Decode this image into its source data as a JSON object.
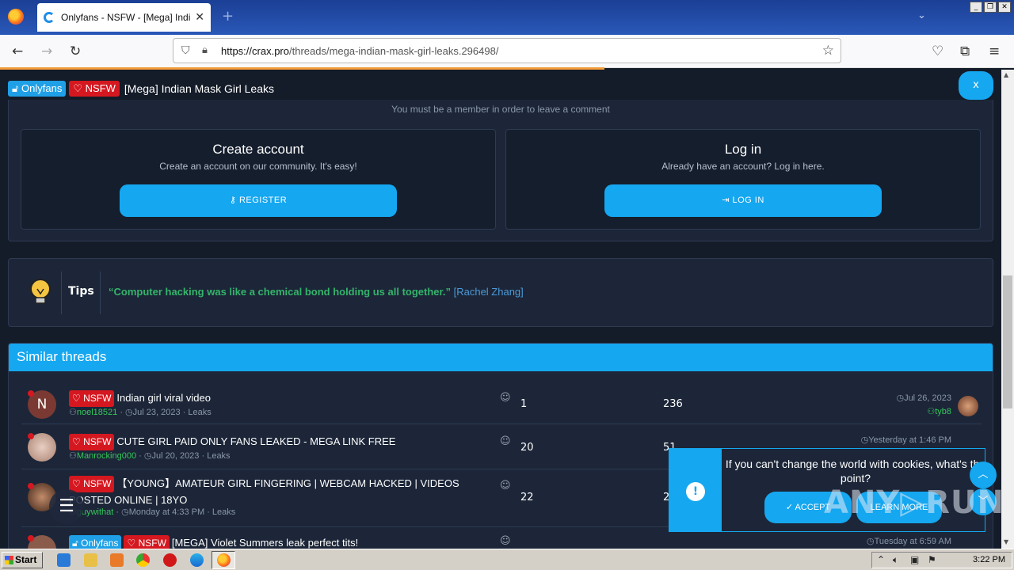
{
  "browser": {
    "tab_title": "Onlyfans - NSFW - [Mega] Indian Mask Girl Leaks",
    "tab_close": "✕",
    "new_tab": "+",
    "url_host": "https://crax.pro",
    "url_path": "/threads/mega-indian-mask-girl-leaks.296498/",
    "window_buttons": [
      "_",
      "❐",
      "✕"
    ],
    "icons": [
      "back-icon",
      "forward-icon",
      "reload-icon",
      "shield-icon",
      "lock-icon",
      "star-icon",
      "pocket-icon",
      "extensions-icon",
      "menu-icon"
    ]
  },
  "thread": {
    "prefix_onlyfans": "Onlyfans",
    "prefix_nsfw": "NSFW",
    "title": "[Mega] Indian Mask Girl Leaks",
    "close_label": "x"
  },
  "comment": {
    "member_note": "You must be a member in order to leave a comment",
    "create_title": "Create account",
    "create_sub": "Create an account on our community. It's easy!",
    "register_label": "REGISTER",
    "login_title": "Log in",
    "login_sub": "Already have an account? Log in here.",
    "login_label": "LOG IN"
  },
  "tips": {
    "label": "Tips",
    "quote": "“Computer hacking was like a chemical bond holding us all together.”",
    "author": "[Rachel Zhang]"
  },
  "similar": {
    "heading": "Similar threads",
    "threads": [
      {
        "avatar_letter": "N",
        "avatar_color": "#7a3a33",
        "prefixes": [
          "NSFW"
        ],
        "title": "Indian girl viral video",
        "author": "noel18521",
        "date": "Jul 23, 2023",
        "forum": "Leaks",
        "replies": "1",
        "views": "236",
        "last_date": "Jul 26, 2023",
        "last_user": "tyb8"
      },
      {
        "avatar_letter": "",
        "avatar_color": "#c9a89a",
        "prefixes": [
          "NSFW"
        ],
        "title": "CUTE GIRL PAID ONLY FANS LEAKED - MEGA LINK FREE",
        "author": "Manrocking000",
        "date": "Jul 20, 2023",
        "forum": "Leaks",
        "replies": "20",
        "views": "51",
        "last_date": "Yesterday at 1:46 PM",
        "last_user": ""
      },
      {
        "avatar_letter": "",
        "avatar_color": "#6b4a3a",
        "prefixes": [
          "NSFW"
        ],
        "title": "【YOUNG】AMATEUR GIRL FINGERING | WEBCAM HACKED | VIDEOS POSTED ONLINE | 18YO",
        "author": "guywithat",
        "date": "Monday at 4:33 PM",
        "forum": "Leaks",
        "replies": "22",
        "views": "2",
        "last_date": "",
        "last_user": ""
      },
      {
        "avatar_letter": "",
        "avatar_color": "#8a5a4a",
        "prefixes": [
          "Onlyfans",
          "NSFW"
        ],
        "title": "[MEGA] Violet Summers leak perfect tits!",
        "author": "",
        "date": "",
        "forum": "",
        "replies": "",
        "views": "",
        "last_date": "Tuesday at 6:59 AM",
        "last_user": ""
      }
    ]
  },
  "cookie": {
    "text": "If you can't change the world with cookies, what's the point?",
    "accept_label": "ACCEPT",
    "learn_label": "LEARN MORE",
    "alert": "!"
  },
  "watermark": "ANY▷RUN",
  "taskbar": {
    "start_label": "Start",
    "clock": "3:22 PM"
  },
  "colors": {
    "accent": "#15a7f0",
    "nsfw": "#d51820",
    "user_green": "#35c75a",
    "page_bg": "#141c29"
  }
}
